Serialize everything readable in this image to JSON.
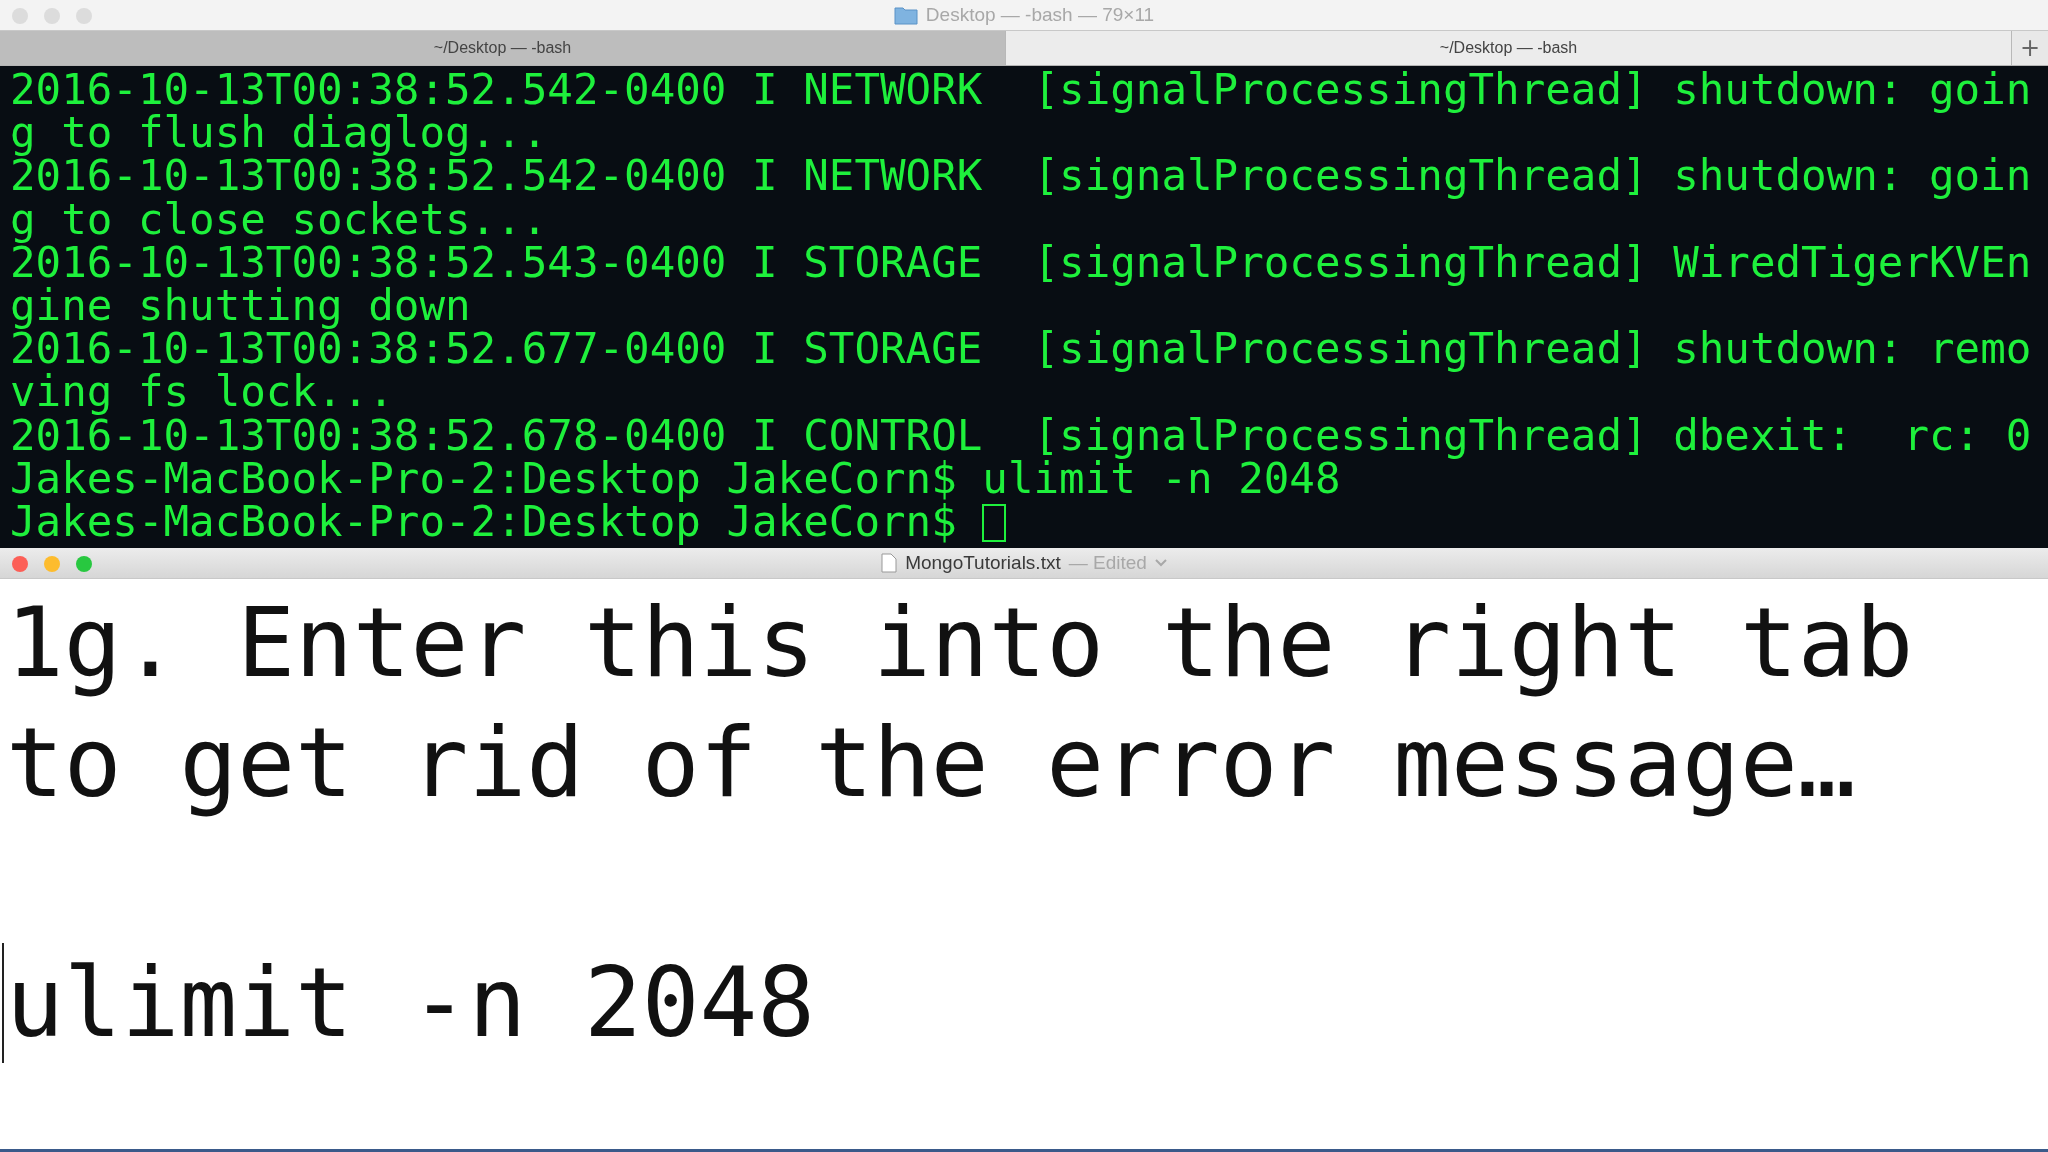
{
  "terminal": {
    "title": "Desktop — -bash — 79×11",
    "tabs": [
      {
        "label": "~/Desktop — -bash",
        "selected": false
      },
      {
        "label": "~/Desktop — -bash",
        "selected": true
      }
    ],
    "new_tab_button": "+",
    "lines": [
      "2016-10-13T00:38:52.542-0400 I NETWORK  [signalProcessingThread] shutdown: going to flush diaglog...",
      "2016-10-13T00:38:52.542-0400 I NETWORK  [signalProcessingThread] shutdown: going to close sockets...",
      "2016-10-13T00:38:52.543-0400 I STORAGE  [signalProcessingThread] WiredTigerKVEngine shutting down",
      "2016-10-13T00:38:52.677-0400 I STORAGE  [signalProcessingThread] shutdown: removing fs lock...",
      "2016-10-13T00:38:52.678-0400 I CONTROL  [signalProcessingThread] dbexit:  rc: 0",
      "Jakes-MacBook-Pro-2:Desktop JakeCorn$ ulimit -n 2048",
      "Jakes-MacBook-Pro-2:Desktop JakeCorn$ "
    ]
  },
  "editor": {
    "title": "MongoTutorials.txt",
    "status": "— Edited",
    "paragraphs": [
      "1g. Enter this into the right tab to get rid of the error message…",
      "ulimit -n 2048"
    ]
  }
}
